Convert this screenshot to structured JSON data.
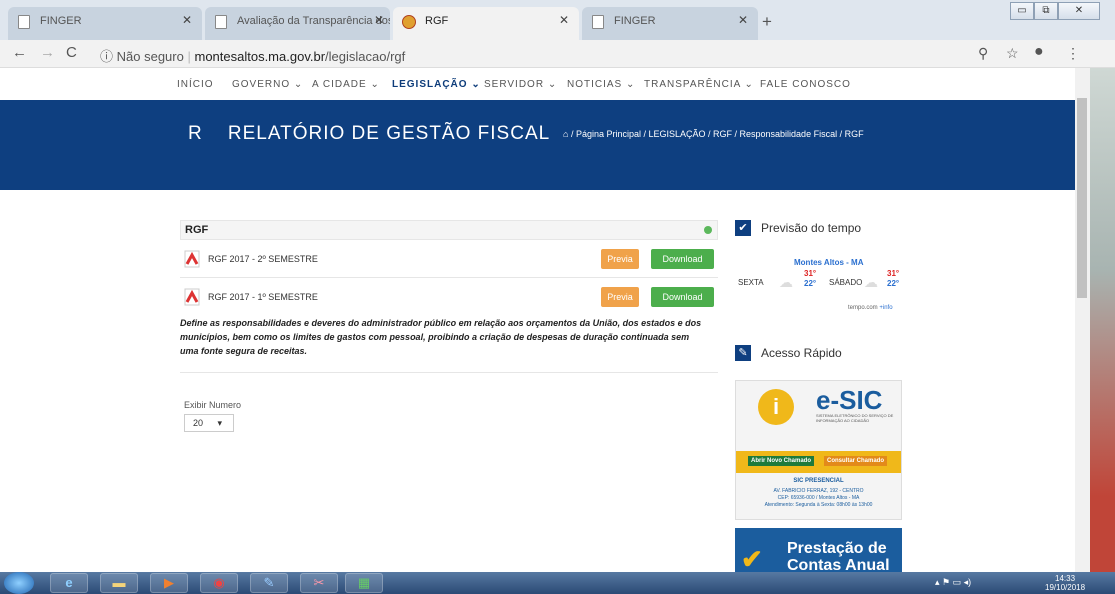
{
  "browser": {
    "tabs": [
      {
        "title": "FINGER",
        "icon": "page-icon"
      },
      {
        "title": "Avaliação da Transparência dos M",
        "icon": "page-icon"
      },
      {
        "title": "RGF",
        "icon": "crest-icon",
        "active": true
      },
      {
        "title": "FINGER",
        "icon": "page-icon"
      }
    ],
    "security": "Não seguro",
    "url_domain": "montesaltos.ma.gov.br",
    "url_path": "/legislacao/rgf"
  },
  "site": {
    "nav": [
      "INÍCIO",
      "GOVERNO",
      "A CIDADE",
      "LEGISLAÇÃO",
      "SERVIDOR",
      "NOTICIAS",
      "TRANSPARÊNCIA",
      "FALE CONOSCO"
    ],
    "active_nav": "LEGISLAÇÃO",
    "page_letter": "R",
    "page_title": "RELATÓRIO DE GESTÃO FISCAL",
    "breadcrumb": "/ Página Principal / LEGISLAÇÃO / RGF / Responsabilidade Fiscal / RGF"
  },
  "content": {
    "section_title": "RGF",
    "rows": [
      {
        "label": "RGF 2017 - 2º SEMESTRE",
        "preview": "Previa",
        "download": "Download"
      },
      {
        "label": "RGF 2017 - 1º SEMESTRE",
        "preview": "Previa",
        "download": "Download"
      }
    ],
    "description": "Define as responsabilidades e deveres do administrador público em relação aos orçamentos da União, dos estados e dos municípios, bem como os limites de gastos com pessoal, proibindo a criação de despesas de duração continuada sem uma fonte segura de receitas.",
    "per_page_label": "Exibir Numero",
    "per_page_value": "20"
  },
  "sidebar": {
    "weather_title": "Previsão do tempo",
    "weather": {
      "city": "Montes Altos - MA",
      "day1": "SEXTA",
      "day1_max": "31°",
      "day1_min": "22°",
      "day2": "SÁBADO",
      "day2_max": "31°",
      "day2_min": "22°",
      "credit": "tempo.com",
      "info": "+info"
    },
    "quick_title": "Acesso Rápido",
    "esic": {
      "logo": "e-SIC",
      "subtitle": "SISTEMA ELETRÔNICO DO SERVIÇO DE INFORMAÇÃO AO CIDADÃO",
      "btn1": "Abrir Novo Chamado",
      "btn2": "Consultar Chamado",
      "sic": "SIC PRESENCIAL",
      "addr1": "AV. FABRICIO FERRAZ, 192 - CENTRO",
      "addr2": "CEP: 65936-000 / Montes Altos - MA",
      "hours": "Atendimento: Segunda à Sexta: 08h00 às 13h00"
    },
    "prestacao": "Prestação de Contas Anual"
  },
  "taskbar": {
    "time": "14:33",
    "date": "19/10/2018"
  }
}
